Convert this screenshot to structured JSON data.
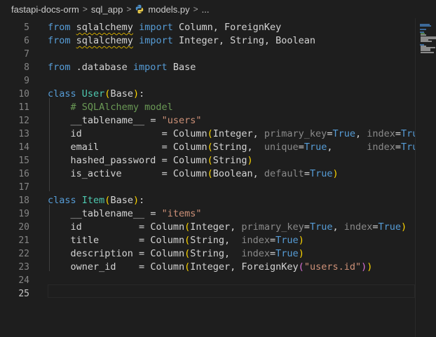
{
  "breadcrumb": {
    "items": [
      "fastapi-docs-orm",
      "sql_app",
      "models.py",
      "..."
    ],
    "separator": ">"
  },
  "editor": {
    "lines": [
      {
        "n": "5",
        "code": "from sqlalchemy import Column, ForeignKey"
      },
      {
        "n": "6",
        "code": "from sqlalchemy import Integer, String, Boolean"
      },
      {
        "n": "7",
        "code": ""
      },
      {
        "n": "8",
        "code": "from .database import Base"
      },
      {
        "n": "9",
        "code": ""
      },
      {
        "n": "10",
        "code": "class User(Base):"
      },
      {
        "n": "11",
        "code": "    # SQLAlchemy model"
      },
      {
        "n": "12",
        "code": "    __tablename__ = \"users\""
      },
      {
        "n": "13",
        "code": "    id              = Column(Integer, primary_key=True, index=True)"
      },
      {
        "n": "14",
        "code": "    email           = Column(String,  unique=True,      index=True)"
      },
      {
        "n": "15",
        "code": "    hashed_password = Column(String)"
      },
      {
        "n": "16",
        "code": "    is_active       = Column(Boolean, default=True)"
      },
      {
        "n": "17",
        "code": ""
      },
      {
        "n": "18",
        "code": "class Item(Base):"
      },
      {
        "n": "19",
        "code": "    __tablename__ = \"items\""
      },
      {
        "n": "20",
        "code": "    id          = Column(Integer, primary_key=True, index=True)"
      },
      {
        "n": "21",
        "code": "    title       = Column(String,  index=True)"
      },
      {
        "n": "22",
        "code": "    description = Column(String,  index=True)"
      },
      {
        "n": "23",
        "code": "    owner_id    = Column(Integer, ForeignKey(\"users.id\"))"
      },
      {
        "n": "24",
        "code": ""
      },
      {
        "n": "25",
        "code": ""
      }
    ]
  },
  "colors": {
    "background": "#1e1e1e",
    "keyword": "#569cd6",
    "class_name": "#4ec9b0",
    "string": "#ce9178",
    "comment": "#6a9955",
    "line_number": "#858585"
  }
}
